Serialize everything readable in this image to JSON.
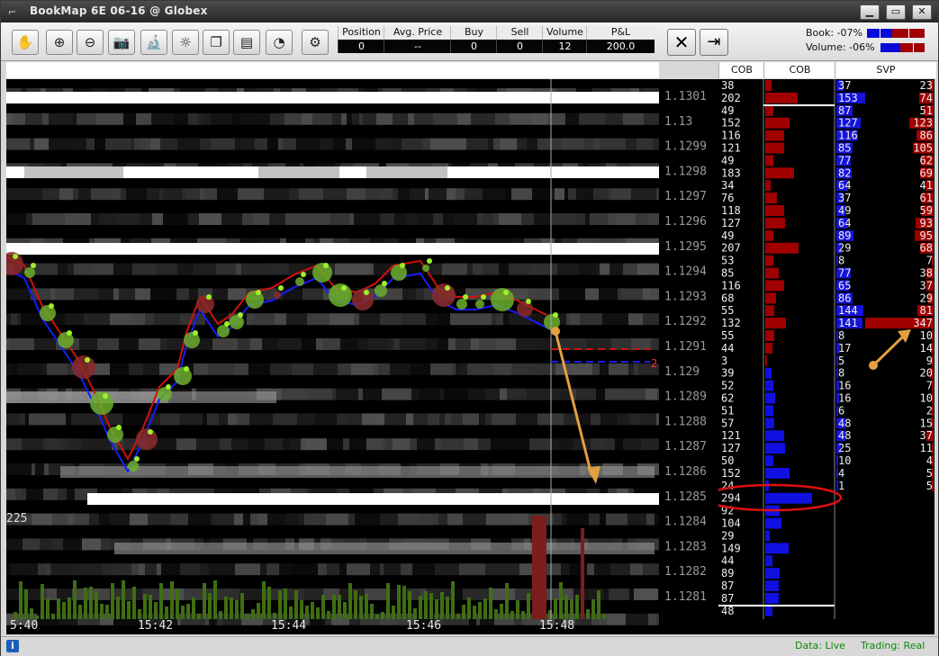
{
  "window": {
    "title": "BookMap    6E 06-16 @ Globex"
  },
  "toolbar": {
    "tools": [
      {
        "name": "hand-pan-icon",
        "glyph": "✋"
      },
      {
        "name": "zoom-in-icon",
        "glyph": "⊕"
      },
      {
        "name": "zoom-out-icon",
        "glyph": "⊖"
      },
      {
        "name": "camera-icon",
        "glyph": "📷"
      },
      {
        "name": "microscope-icon",
        "glyph": "🔬"
      },
      {
        "name": "brightness-icon",
        "glyph": "☼"
      },
      {
        "name": "clone-icon",
        "glyph": "❐"
      },
      {
        "name": "chat-icon",
        "glyph": "▤"
      },
      {
        "name": "pie-chart-icon",
        "glyph": "◔"
      }
    ],
    "settings_glyph": "⚙",
    "stats": [
      {
        "label": "Position",
        "value": "0"
      },
      {
        "label": "Avg. Price",
        "value": "--"
      },
      {
        "label": "Buy",
        "value": "0"
      },
      {
        "label": "Sell",
        "value": "0"
      },
      {
        "label": "Volume",
        "value": "12"
      },
      {
        "label": "P&L",
        "value": "200.0"
      }
    ],
    "cancel_glyph": "✕",
    "exit_glyph": "⇥",
    "book_imbalance": "Book: -07%",
    "volume_imbalance": "Volume: -06%"
  },
  "columns": {
    "cob1": "COB",
    "cob2": "COB",
    "svp": "SVP"
  },
  "chart": {
    "volume_scale_label": "225",
    "order_marker_label": "2",
    "time_labels": [
      "5:40",
      "15:42",
      "15:44",
      "15:46",
      "15:48"
    ],
    "price_labels": [
      "1.1301",
      "1.13",
      "1.1299",
      "1.1298",
      "1.1297",
      "1.1296",
      "1.1295",
      "1.1294",
      "1.1293",
      "1.1292",
      "1.1291",
      "1.129",
      "1.1289",
      "1.1288",
      "1.1287",
      "1.1286",
      "1.1285",
      "1.1284",
      "1.1283",
      "1.1282",
      "1.1281"
    ]
  },
  "ladder": {
    "cob_sizes": [
      "38",
      "202",
      "49",
      "152",
      "116",
      "121",
      "49",
      "183",
      "34",
      "76",
      "118",
      "127",
      "49",
      "207",
      "53",
      "85",
      "116",
      "68",
      "55",
      "132",
      "55",
      "44",
      "3",
      "39",
      "52",
      "62",
      "51",
      "57",
      "121",
      "127",
      "50",
      "152",
      "24",
      "294",
      "92",
      "104",
      "29",
      "149",
      "44",
      "89",
      "87",
      "87",
      "48"
    ],
    "svp_bid": [
      "37",
      "153",
      "87",
      "127",
      "116",
      "85",
      "77",
      "82",
      "64",
      "37",
      "49",
      "64",
      "89",
      "29",
      "8",
      "77",
      "65",
      "86",
      "144",
      "141",
      "8",
      "17",
      "5",
      "8",
      "16",
      "16",
      "6",
      "48",
      "48",
      "25",
      "10",
      "4",
      "1"
    ],
    "svp_ask": [
      "23",
      "74",
      "51",
      "123",
      "86",
      "105",
      "62",
      "69",
      "41",
      "61",
      "59",
      "93",
      "95",
      "68",
      "7",
      "38",
      "37",
      "29",
      "81",
      "347",
      "10",
      "14",
      "9",
      "20",
      "7",
      "10",
      "2",
      "15",
      "37",
      "11",
      "4",
      "5",
      "5"
    ],
    "colors": {
      "bid": "#1010e0",
      "ask": "#a00000",
      "highlight_bid": "#1414d8",
      "highlight_ask": "#a00000"
    }
  },
  "status": {
    "data": "Data: Live",
    "trading": "Trading: Real"
  }
}
